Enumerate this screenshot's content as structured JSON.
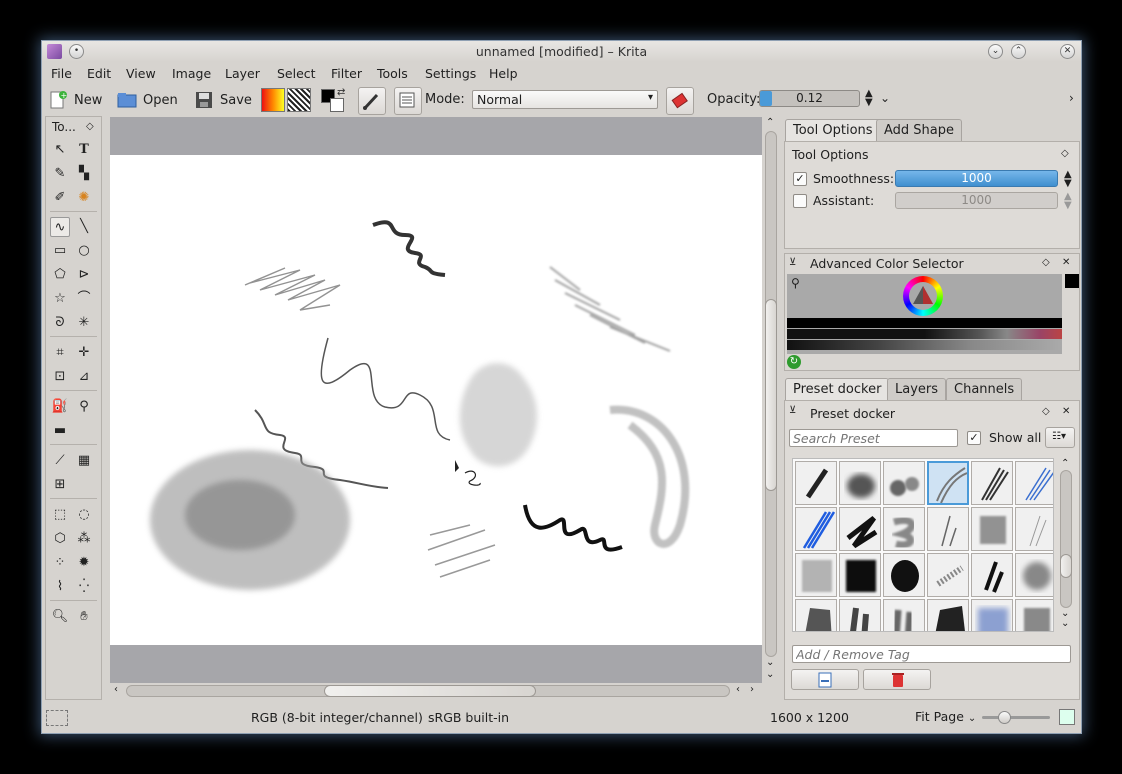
{
  "window": {
    "title": "unnamed [modified] – Krita"
  },
  "menu": [
    "File",
    "Edit",
    "View",
    "Image",
    "Layer",
    "Select",
    "Filter",
    "Tools",
    "Settings",
    "Help"
  ],
  "toolbar": {
    "new_label": "New",
    "open_label": "Open",
    "save_label": "Save",
    "mode_label": "Mode:",
    "mode_value": "Normal",
    "opacity_label": "Opacity:",
    "opacity_value": "0.12",
    "opacity_fraction": 0.12
  },
  "toolbox": {
    "title": "To..."
  },
  "right_tabs_top": {
    "tab_tool_options": "Tool Options",
    "tab_add_shape": "Add Shape"
  },
  "tool_options": {
    "header": "Tool Options",
    "smoothness_label": "Smoothness:",
    "smoothness_value": "1000",
    "assistant_label": "Assistant:",
    "assistant_value": "1000"
  },
  "color_selector": {
    "title": "Advanced Color Selector"
  },
  "right_tabs_bottom": {
    "tab_preset": "Preset docker",
    "tab_layers": "Layers",
    "tab_channels": "Channels"
  },
  "preset_docker": {
    "title": "Preset docker",
    "search_placeholder": "Search Preset",
    "show_all_label": "Show all",
    "tag_placeholder": "Add / Remove Tag"
  },
  "status": {
    "color_model": "RGB (8-bit integer/channel)",
    "profile": "sRGB built-in",
    "dimensions": "1600 x 1200",
    "zoom": "Fit Page"
  },
  "colors": {
    "accent": "#4a9ad8",
    "foreground": "#000000",
    "background": "#ffffff",
    "canvas_bg": "#a6a6aa"
  }
}
